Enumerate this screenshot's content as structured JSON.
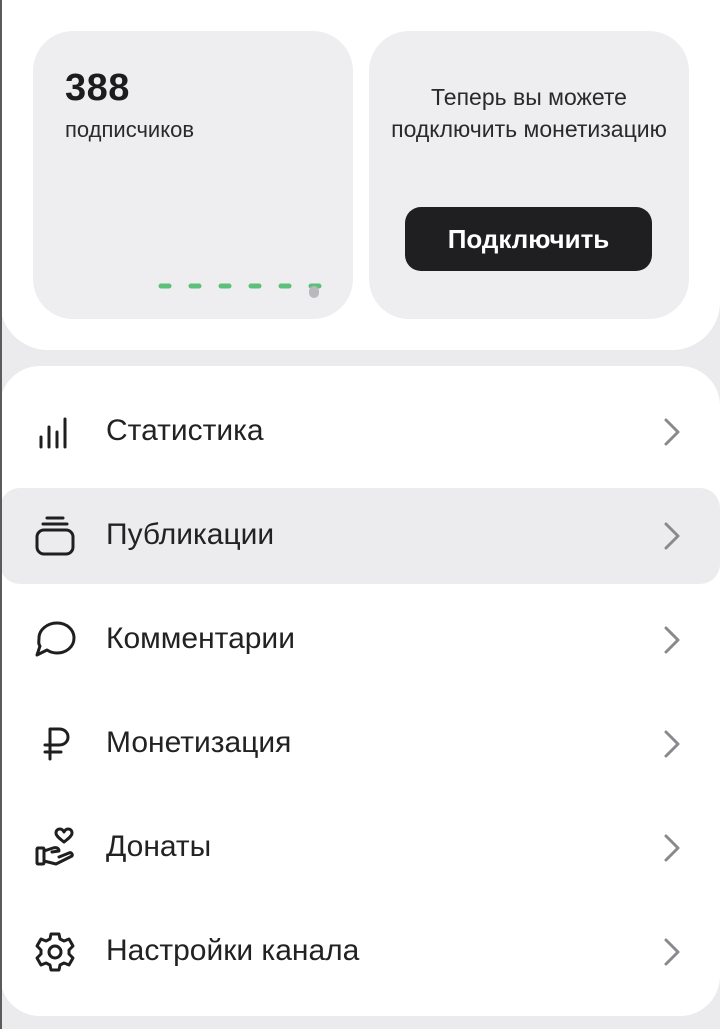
{
  "subscribers": {
    "count": "388",
    "label": "подписчиков"
  },
  "monetization_card": {
    "text": "Теперь вы можете подключить монетизацию",
    "button_label": "Подключить"
  },
  "menu": {
    "items": [
      {
        "label": "Статистика",
        "icon": "bar-chart-icon"
      },
      {
        "label": "Публикации",
        "icon": "publications-stack-icon"
      },
      {
        "label": "Комментарии",
        "icon": "speech-bubble-icon"
      },
      {
        "label": "Монетизация",
        "icon": "ruble-icon"
      },
      {
        "label": "Донаты",
        "icon": "hand-heart-icon"
      },
      {
        "label": "Настройки канала",
        "icon": "gear-icon"
      }
    ]
  },
  "colors": {
    "accent_green": "#5cbf7a",
    "button_dark": "#1f1f21",
    "card_bg": "#eeeef0",
    "active_row_bg": "#ececee"
  }
}
